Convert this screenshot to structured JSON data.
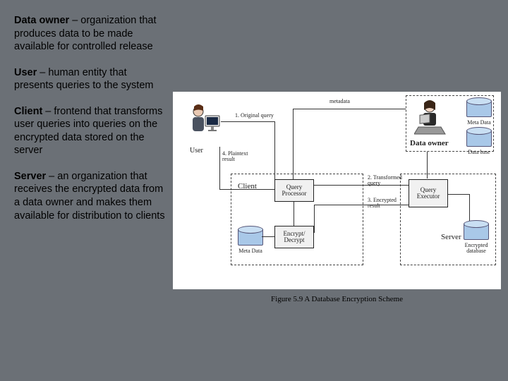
{
  "definitions": {
    "data_owner": {
      "term": "Data owner",
      "rest": " – organization that produces data to be made available for controlled release"
    },
    "user": {
      "term": "User",
      "rest": " – human entity that presents queries to the system"
    },
    "client": {
      "term": "Client",
      "rest": " – frontend that transforms user queries into queries on the encrypted data stored on the server"
    },
    "server": {
      "term": "Server",
      "rest": " – an organization that receives the encrypted data from a data owner and makes them available for distribution to clients"
    }
  },
  "figure": {
    "caption": "Figure 5.9  A Database Encryption Scheme",
    "entities": {
      "user": "User",
      "client": "Client",
      "server": "Server",
      "data_owner": "Data owner",
      "query_processor": "Query Processor",
      "encrypt_decrypt": "Encrypt/ Decrypt",
      "query_executor": "Query Executor",
      "meta_data_client": "Meta Data",
      "meta_data_owner": "Meta Data",
      "data_base": "Data base",
      "encrypted_db": "Encrypted database"
    },
    "flows": {
      "original_query": "1. Original query",
      "transformed_query": "2. Transformed query",
      "encrypted_result": "3. Encrypted result",
      "plaintext_result": "4. Plaintext result",
      "metadata": "metadata"
    }
  }
}
